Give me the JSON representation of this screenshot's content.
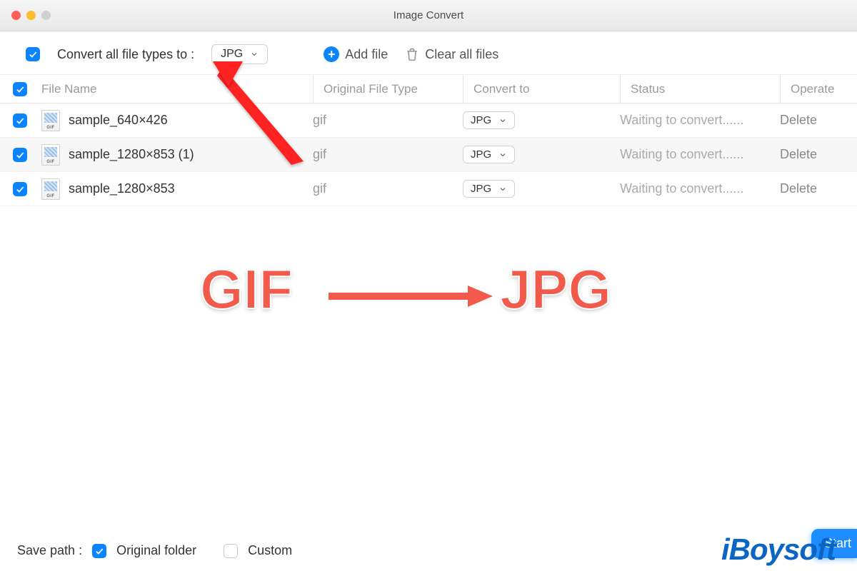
{
  "window": {
    "title": "Image Convert"
  },
  "toolbar": {
    "convert_all_label": "Convert all file types to :",
    "convert_all_checked": true,
    "format_selected": "JPG",
    "add_file_label": "Add file",
    "clear_label": "Clear all files"
  },
  "table": {
    "headers": {
      "name": "File Name",
      "original": "Original File Type",
      "convert": "Convert to",
      "status": "Status",
      "operate": "Operate"
    },
    "rows": [
      {
        "checked": true,
        "name": "sample_640×426",
        "original": "gif",
        "convert": "JPG",
        "status": "Waiting to convert......",
        "operate": "Delete"
      },
      {
        "checked": true,
        "name": "sample_1280×853 (1)",
        "original": "gif",
        "convert": "JPG",
        "status": "Waiting to convert......",
        "operate": "Delete"
      },
      {
        "checked": true,
        "name": "sample_1280×853",
        "original": "gif",
        "convert": "JPG",
        "status": "Waiting to convert......",
        "operate": "Delete"
      }
    ]
  },
  "footer": {
    "save_path_label": "Save path :",
    "original_folder_label": "Original folder",
    "original_folder_checked": true,
    "custom_label": "Custom",
    "custom_checked": false,
    "start_label": "Start"
  },
  "annotation": {
    "left_text": "GIF",
    "right_text": "JPG",
    "brand": "iBoysoft"
  },
  "colors": {
    "accent": "#0a84ff",
    "annotation": "#f25b4c",
    "brand": "#0a66c2"
  }
}
